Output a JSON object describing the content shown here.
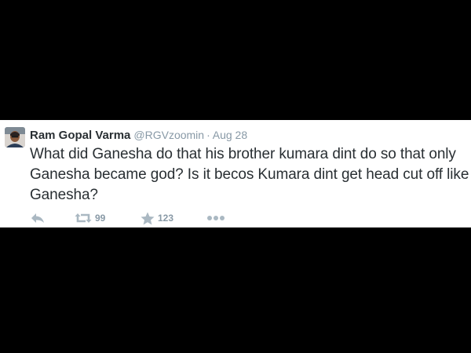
{
  "tweet": {
    "author_name": "Ram Gopal Varma",
    "author_handle": "@RGVzoomin",
    "separator": "·",
    "timestamp": "Aug 28",
    "text_lines": [
      "What did Ganesha do that his brother kumara dint do so that only",
      "Ganesha became god? Is it becos Kumara dint get head cut off like",
      "Ganesha?"
    ],
    "retweet_count": "99",
    "favorite_count": "123"
  },
  "icons": {
    "avatar": "avatar-photo",
    "reply": "reply-icon",
    "retweet": "retweet-icon",
    "favorite": "star-icon",
    "more": "more-dots-icon"
  },
  "colors": {
    "background": "#000000",
    "card": "#ffffff",
    "text": "#292f33",
    "muted": "#8899a6",
    "icon": "#aab8c2"
  }
}
